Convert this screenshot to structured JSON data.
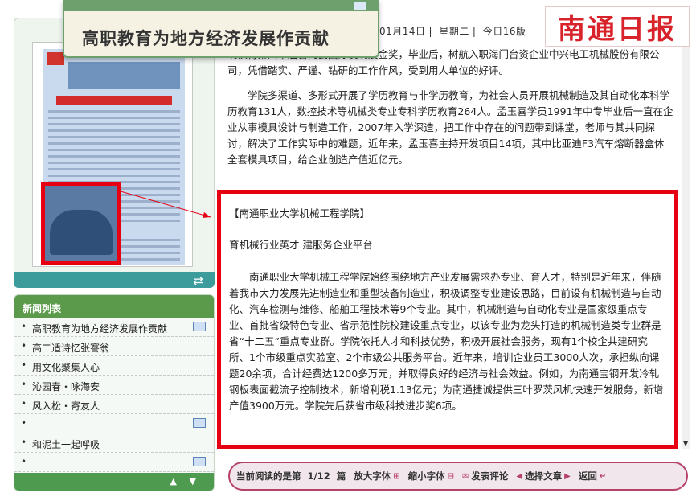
{
  "header": {
    "date_parts": [
      "01月14日",
      "星期二",
      "今日16版"
    ],
    "brand": "南通日报"
  },
  "popup_title": "高职教育为地方经济发展作贡献",
  "news_list": {
    "heading": "新闻列表",
    "items": [
      {
        "label": "高职教育为地方经济发展作贡献",
        "has_pic": true
      },
      {
        "label": "高二适诗忆张謇翁",
        "has_pic": false
      },
      {
        "label": "用文化聚集人心",
        "has_pic": false
      },
      {
        "label": "沁园春・咏海安",
        "has_pic": false
      },
      {
        "label": "风入松・寄友人",
        "has_pic": false
      },
      {
        "label": "",
        "has_pic": true
      },
      {
        "label": "和泥土一起呼吸",
        "has_pic": false
      },
      {
        "label": "",
        "has_pic": true
      }
    ]
  },
  "article": {
    "top_paragraphs": [
      "明获得第四十届日内瓦国际发明展金奖，毕业后，树航入职海门台资企业中兴电工机械股份有限公司，凭借踏实、严谨、钻研的工作作风，受到用人单位的好评。",
      "学院多渠道、多形式开展了学历教育与非学历教育，为社会人员开展机械制造及其自动化本科学历教育131人，数控技术等机械类专业专科学历教育264人。孟玉喜学员1991年中专毕业后一直在企业从事模具设计与制造工作，2007年入学深造，把工作中存在的问题带到课堂，老师与其共同探讨，解决了工作实际中的难题，近年来，孟玉喜主持开发项目14项，其中比亚迪F3汽车熔断器盒体全套模具项目，给企业创造产值近亿元。"
    ],
    "section_title": "【南通职业大学机械工程学院】",
    "subtitle": "育机械行业英才 建服务企业平台",
    "body": "南通职业大学机械工程学院始终围绕地方产业发展需求办专业、育人才，特别是近年来，伴随着我市大力发展先进制造业和重型装备制造业，积极调整专业建设思路，目前设有机械制造与自动化、汽车检测与维修、船舶工程技术等9个专业。其中，机械制造与自动化专业是国家级重点专业、首批省级特色专业、省示范性院校建设重点专业，以该专业为龙头打造的机械制造类专业群是省“十二五”重点专业群。学院依托人才和科技优势，积极开展社会服务，现有1个校企共建研究所、1个市级重点实验室、2个市级公共服务平台。近年来，培训企业员工3000人次，承担纵向课题20余项，合计经费达1200多万元，并取得良好的经济与社会效益。例如，为南通宝钢开发冷轧钢板表面截流子控制技术，新增利税1.13亿元；为南通捷诚提供三叶罗茨风机快速开发服务，新增产值3900万元。学院先后获省市级科技进步奖6项。"
  },
  "toolbar": {
    "reading_prefix": "当前阅读的是第",
    "page_indicator": "1/12",
    "reading_suffix": "篇",
    "enlarge": "放大字体",
    "shrink": "缩小字体",
    "comment": "发表评论",
    "select": "选择文章",
    "back": "返回"
  },
  "colors": {
    "accent_red": "#e60012",
    "brand_red": "#d8232a",
    "green": "#5a9a4a",
    "toolbar_border": "#b6416a"
  }
}
